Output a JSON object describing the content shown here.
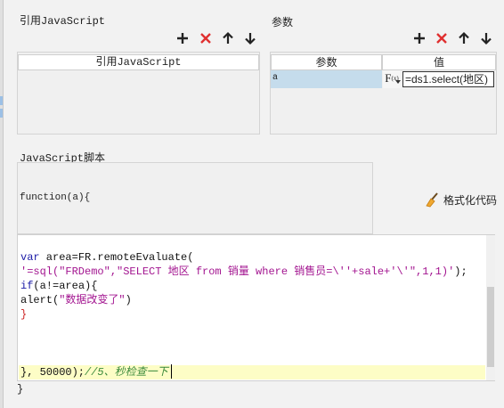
{
  "ref_js": {
    "title": "引用JavaScript",
    "column_header": "引用JavaScript"
  },
  "params": {
    "title": "参数",
    "col_name": "参数",
    "col_value": "值",
    "rows": [
      {
        "name": "a",
        "fx": "F",
        "fx_sub": "(x)",
        "value": "=ds1.select(地区)"
      }
    ]
  },
  "script": {
    "title": "JavaScript脚本",
    "signature": "function(a){",
    "format_button_label": "格式化代码",
    "closing_brace": "}",
    "code_lines": [
      {
        "segments": [
          {
            "t": "var",
            "c": "kw"
          },
          {
            "t": " area=FR.remoteEvaluate(",
            "c": "pl"
          }
        ]
      },
      {
        "segments": [
          {
            "t": "'=sql(\"FRDemo\",\"SELECT 地区 from 销量 where 销售员=\\''+sale+'\\'\",1,1)'",
            "c": "str"
          },
          {
            "t": ");",
            "c": "pl"
          }
        ]
      },
      {
        "segments": [
          {
            "t": "if",
            "c": "kw"
          },
          {
            "t": "(a!=area){",
            "c": "pl"
          }
        ]
      },
      {
        "segments": [
          {
            "t": "alert(",
            "c": "pl"
          },
          {
            "t": "\"数据改变了\"",
            "c": "str"
          },
          {
            "t": ")",
            "c": "pl"
          }
        ]
      },
      {
        "segments": [
          {
            "t": "}",
            "c": "str2"
          }
        ]
      },
      {
        "segments": []
      },
      {
        "segments": []
      },
      {
        "segments": [
          {
            "t": "}, 50000);",
            "c": "pl"
          },
          {
            "t": "//5、秒检查一下",
            "c": "cmt"
          }
        ]
      }
    ]
  },
  "icons": {
    "add": "plus-icon",
    "delete": "close-icon",
    "up": "arrow-up-icon",
    "down": "arrow-down-icon",
    "format": "broom-icon"
  },
  "colors": {
    "add": "#222222",
    "delete": "#e03030",
    "selected_cell": "#c5dcec",
    "highlight_line": "#fdfdc6"
  }
}
